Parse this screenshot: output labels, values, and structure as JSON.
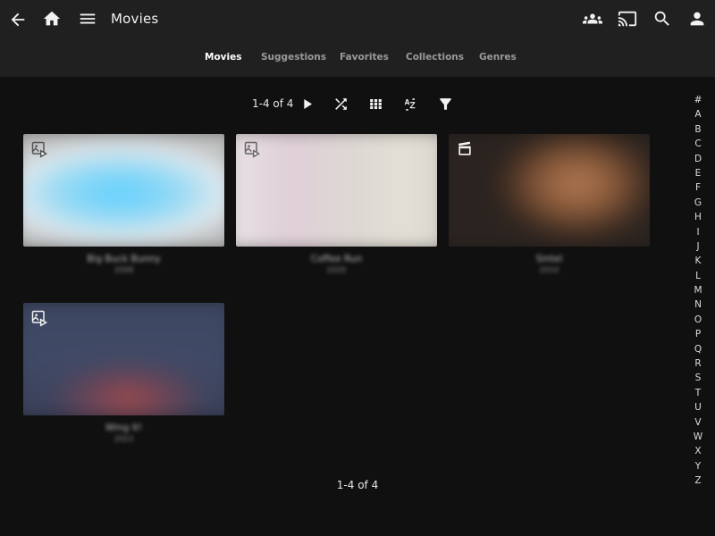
{
  "header": {
    "title": "Movies",
    "tabs": [
      {
        "label": "Movies",
        "active": true
      },
      {
        "label": "Suggestions",
        "active": false
      },
      {
        "label": "Favorites",
        "active": false
      },
      {
        "label": "Collections",
        "active": false
      },
      {
        "label": "Genres",
        "active": false
      }
    ],
    "left_icons": [
      "back-arrow-icon",
      "home-icon",
      "menu-icon"
    ],
    "right_icons": [
      "people-icon",
      "cast-icon",
      "search-icon",
      "user-icon"
    ]
  },
  "toolbar": {
    "counter": "1-4 of 4",
    "icons": [
      "play-icon",
      "shuffle-icon",
      "grid-view-icon",
      "sort-az-icon",
      "filter-icon"
    ]
  },
  "movies": [
    {
      "title": "Big Buck Bunny",
      "year": "2008",
      "badge": "image-video-icon"
    },
    {
      "title": "Coffee Run",
      "year": "2020",
      "badge": "image-video-icon"
    },
    {
      "title": "Sintel",
      "year": "2010",
      "badge": "clapperboard-icon"
    },
    {
      "title": "Wing It!",
      "year": "2023",
      "badge": "image-video-icon"
    }
  ],
  "footer": {
    "counter": "1-4 of 4"
  },
  "alphabet": [
    "#",
    "A",
    "B",
    "C",
    "D",
    "E",
    "F",
    "G",
    "H",
    "I",
    "J",
    "K",
    "L",
    "M",
    "N",
    "O",
    "P",
    "Q",
    "R",
    "S",
    "T",
    "U",
    "V",
    "W",
    "X",
    "Y",
    "Z"
  ],
  "colors": {
    "header_bg": "#202020",
    "page_bg": "#101010",
    "active_tab": "#ffffff",
    "inactive_tab": "#9a9a9a"
  }
}
